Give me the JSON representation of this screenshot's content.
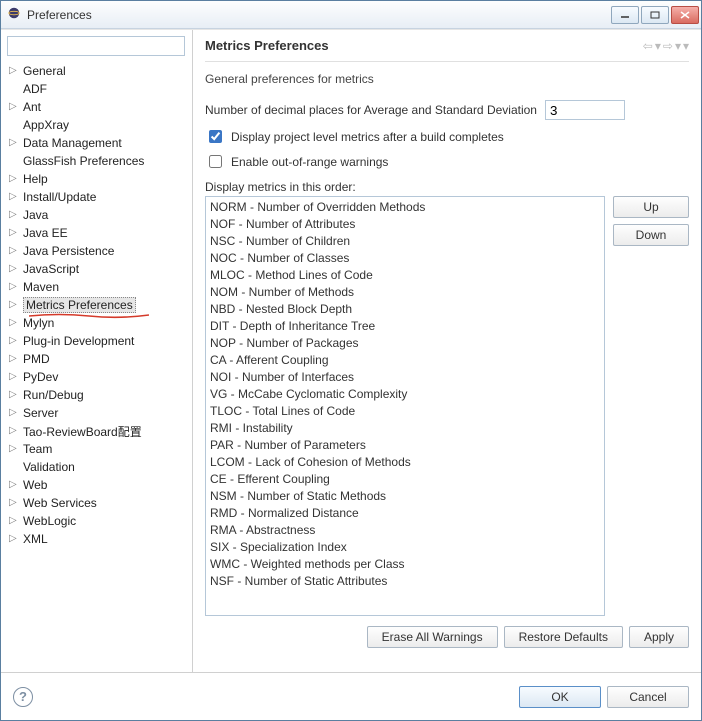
{
  "window": {
    "title": "Preferences"
  },
  "sidebar": {
    "filter_value": "",
    "items": [
      {
        "label": "General",
        "expandable": true
      },
      {
        "label": "ADF",
        "expandable": false
      },
      {
        "label": "Ant",
        "expandable": true
      },
      {
        "label": "AppXray",
        "expandable": false
      },
      {
        "label": "Data Management",
        "expandable": true
      },
      {
        "label": "GlassFish Preferences",
        "expandable": false
      },
      {
        "label": "Help",
        "expandable": true
      },
      {
        "label": "Install/Update",
        "expandable": true
      },
      {
        "label": "Java",
        "expandable": true
      },
      {
        "label": "Java EE",
        "expandable": true
      },
      {
        "label": "Java Persistence",
        "expandable": true
      },
      {
        "label": "JavaScript",
        "expandable": true
      },
      {
        "label": "Maven",
        "expandable": true
      },
      {
        "label": "Metrics Preferences",
        "expandable": true,
        "selected": true
      },
      {
        "label": "Mylyn",
        "expandable": true
      },
      {
        "label": "Plug-in Development",
        "expandable": true
      },
      {
        "label": "PMD",
        "expandable": true
      },
      {
        "label": "PyDev",
        "expandable": true
      },
      {
        "label": "Run/Debug",
        "expandable": true
      },
      {
        "label": "Server",
        "expandable": true
      },
      {
        "label": "Tao-ReviewBoard配置",
        "expandable": true
      },
      {
        "label": "Team",
        "expandable": true
      },
      {
        "label": "Validation",
        "expandable": false
      },
      {
        "label": "Web",
        "expandable": true
      },
      {
        "label": "Web Services",
        "expandable": true
      },
      {
        "label": "WebLogic",
        "expandable": true
      },
      {
        "label": "XML",
        "expandable": true
      }
    ]
  },
  "main": {
    "title": "Metrics Preferences",
    "description": "General preferences for metrics",
    "decimals_label": "Number of decimal places for Average and Standard Deviation",
    "decimals_value": "3",
    "cb_project_label": "Display project level metrics after a build completes",
    "cb_project_checked": true,
    "cb_range_label": "Enable out-of-range warnings",
    "cb_range_checked": false,
    "order_label": "Display metrics in this order:",
    "metrics": [
      "NORM - Number of Overridden Methods",
      "NOF - Number of Attributes",
      "NSC - Number of Children",
      "NOC - Number of Classes",
      "MLOC - Method Lines of Code",
      "NOM - Number of Methods",
      "NBD - Nested Block Depth",
      "DIT - Depth of Inheritance Tree",
      "NOP - Number of Packages",
      "CA - Afferent Coupling",
      "NOI - Number of Interfaces",
      "VG - McCabe Cyclomatic Complexity",
      "TLOC - Total Lines of Code",
      "RMI - Instability",
      "PAR - Number of Parameters",
      "LCOM - Lack of Cohesion of Methods",
      "CE - Efferent Coupling",
      "NSM - Number of Static Methods",
      "RMD - Normalized Distance",
      "RMA - Abstractness",
      "SIX - Specialization Index",
      "WMC - Weighted methods per Class",
      "NSF - Number of Static Attributes"
    ],
    "buttons": {
      "up": "Up",
      "down": "Down",
      "erase": "Erase All Warnings",
      "restore": "Restore Defaults",
      "apply": "Apply",
      "ok": "OK",
      "cancel": "Cancel"
    }
  }
}
